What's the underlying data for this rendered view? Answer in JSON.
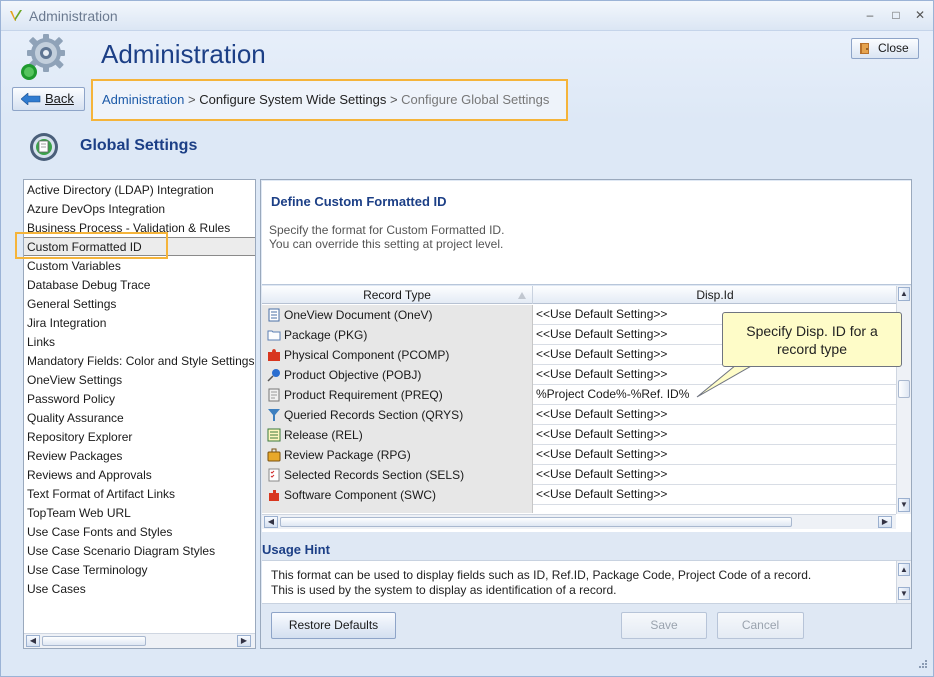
{
  "window": {
    "title": "Administration",
    "min_symbol": "–",
    "max_symbol": "□",
    "close_symbol": "✕"
  },
  "header": {
    "title": "Administration",
    "close_label": "Close",
    "back_label": "Back"
  },
  "breadcrumb": {
    "link": "Administration",
    "sep1": " > ",
    "middle": "Configure System Wide Settings",
    "sep2": " > ",
    "current": "Configure Global Settings"
  },
  "section": {
    "title": "Global Settings"
  },
  "left_list": {
    "items": [
      "Active Directory (LDAP) Integration",
      "Azure DevOps Integration",
      "Business Process - Validation & Rules",
      "Custom Formatted ID",
      "Custom Variables",
      "Database Debug Trace",
      "General Settings",
      "Jira Integration",
      "Links",
      "Mandatory Fields: Color and Style Settings",
      "OneView Settings",
      "Password Policy",
      "Quality Assurance",
      "Repository Explorer",
      "Review Packages",
      "Reviews and Approvals",
      "Text Format of Artifact Links",
      "TopTeam Web URL",
      "Use Case Fonts and Styles",
      "Use Case Scenario Diagram Styles",
      "Use Case Terminology",
      "Use Cases"
    ],
    "selected": "Custom Formatted ID"
  },
  "define": {
    "title": "Define Custom Formatted ID",
    "desc_line1": "Specify the format for Custom Formatted ID.",
    "desc_line2": "You can override this setting at project level."
  },
  "grid": {
    "columns": [
      "Record Type",
      "Disp.Id"
    ],
    "rows": [
      {
        "type": "OneView Document (OneV)",
        "value": "<<Use Default Setting>>",
        "icon": "document-icon"
      },
      {
        "type": "Package (PKG)",
        "value": "<<Use Default Setting>>",
        "icon": "folder-icon"
      },
      {
        "type": "Physical Component (PCOMP)",
        "value": "<<Use Default Setting>>",
        "icon": "puzzle-icon"
      },
      {
        "type": "Product Objective (POBJ)",
        "value": "<<Use Default Setting>>",
        "icon": "pin-icon"
      },
      {
        "type": "Product Requirement (PREQ)",
        "value": "%Project Code%-%Ref. ID%",
        "icon": "page-icon"
      },
      {
        "type": "Queried Records Section (QRYS)",
        "value": "<<Use Default Setting>>",
        "icon": "funnel-icon"
      },
      {
        "type": "Release (REL)",
        "value": "<<Use Default Setting>>",
        "icon": "list-icon"
      },
      {
        "type": "Review Package (RPG)",
        "value": "<<Use Default Setting>>",
        "icon": "briefcase-icon"
      },
      {
        "type": "Selected Records Section (SELS)",
        "value": "<<Use Default Setting>>",
        "icon": "checklist-icon"
      },
      {
        "type": "Software Component (SWC)",
        "value": "<<Use Default Setting>>",
        "icon": "component-icon"
      }
    ]
  },
  "callout": {
    "line1": "Specify Disp. ID for a",
    "line2": "record type"
  },
  "usage": {
    "title": "Usage Hint",
    "line1": "This format can be used to display fields such as ID, Ref.ID, Package Code, Project Code of a record.",
    "line2": "This is used by the system to display as identification of a record."
  },
  "buttons": {
    "restore": "Restore Defaults",
    "save": "Save",
    "cancel": "Cancel"
  },
  "colors": {
    "accent_title": "#1c3f86",
    "highlight_border": "#f5b43a",
    "callout_bg": "#fefcc8"
  }
}
